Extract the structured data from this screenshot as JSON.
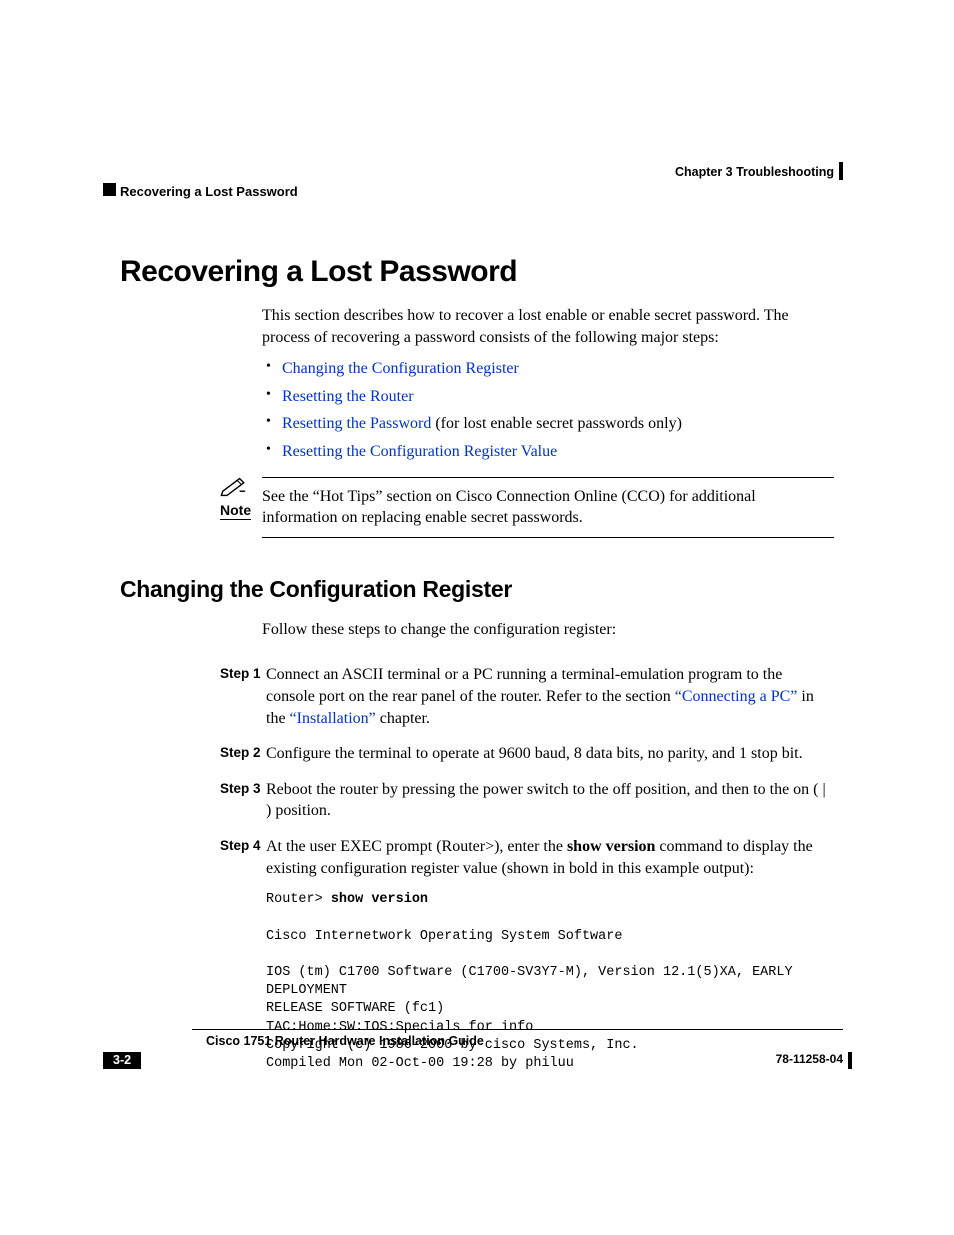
{
  "header": {
    "chapter": "Chapter 3    Troubleshooting",
    "section": "Recovering a Lost Password"
  },
  "h1": "Recovering a Lost Password",
  "intro": "This section describes how to recover a lost enable or enable secret password. The process of recovering a password consists of the following major steps:",
  "bullets": {
    "b1": "Changing the Configuration Register",
    "b2": "Resetting the Router",
    "b3_link": "Resetting the Password",
    "b3_tail": " (for lost enable secret passwords only)",
    "b4": "Resetting the Configuration Register Value"
  },
  "note": {
    "label": "Note",
    "text": "See the “Hot Tips” section on Cisco Connection Online (CCO) for additional information on replacing enable secret passwords."
  },
  "h2": "Changing the Configuration Register",
  "h2_intro": "Follow these steps to change the configuration register:",
  "steps": {
    "s1_label": "Step 1",
    "s1_a": "Connect an ASCII terminal or a PC running a terminal-emulation program to the console port on the rear panel of the router. Refer to the section ",
    "s1_link1": "“Connecting a PC”",
    "s1_b": " in the ",
    "s1_link2": "“Installation”",
    "s1_c": " chapter.",
    "s2_label": "Step 2",
    "s2": "Configure the terminal to operate at 9600 baud, 8 data bits, no parity, and 1 stop bit.",
    "s3_label": "Step 3",
    "s3": "Reboot the router by pressing the power switch to the off position, and then to the on ( | ) position.",
    "s4_label": "Step 4",
    "s4_a": "At the user EXEC prompt (Router>), enter the ",
    "s4_bold": "show version",
    "s4_b": " command to display the existing configuration register value (shown in bold in this example output):"
  },
  "code": {
    "prompt": "Router> ",
    "cmd": "show version",
    "line2": "Cisco Internetwork Operating System Software",
    "line3": "IOS (tm) C1700 Software (C1700-SV3Y7-M), Version 12.1(5)XA, EARLY",
    "line4": "DEPLOYMENT",
    "line5": "RELEASE SOFTWARE (fc1)",
    "line6": "TAC:Home:SW:IOS:Specials for info",
    "line7": "Copyright (c) 1986-2000 by cisco Systems, Inc.",
    "line8": "Compiled Mon 02-Oct-00 19:28 by philuu"
  },
  "footer": {
    "title": "Cisco 1751 Router Hardware Installation Guide",
    "page": "3-2",
    "docnum": "78-11258-04"
  }
}
